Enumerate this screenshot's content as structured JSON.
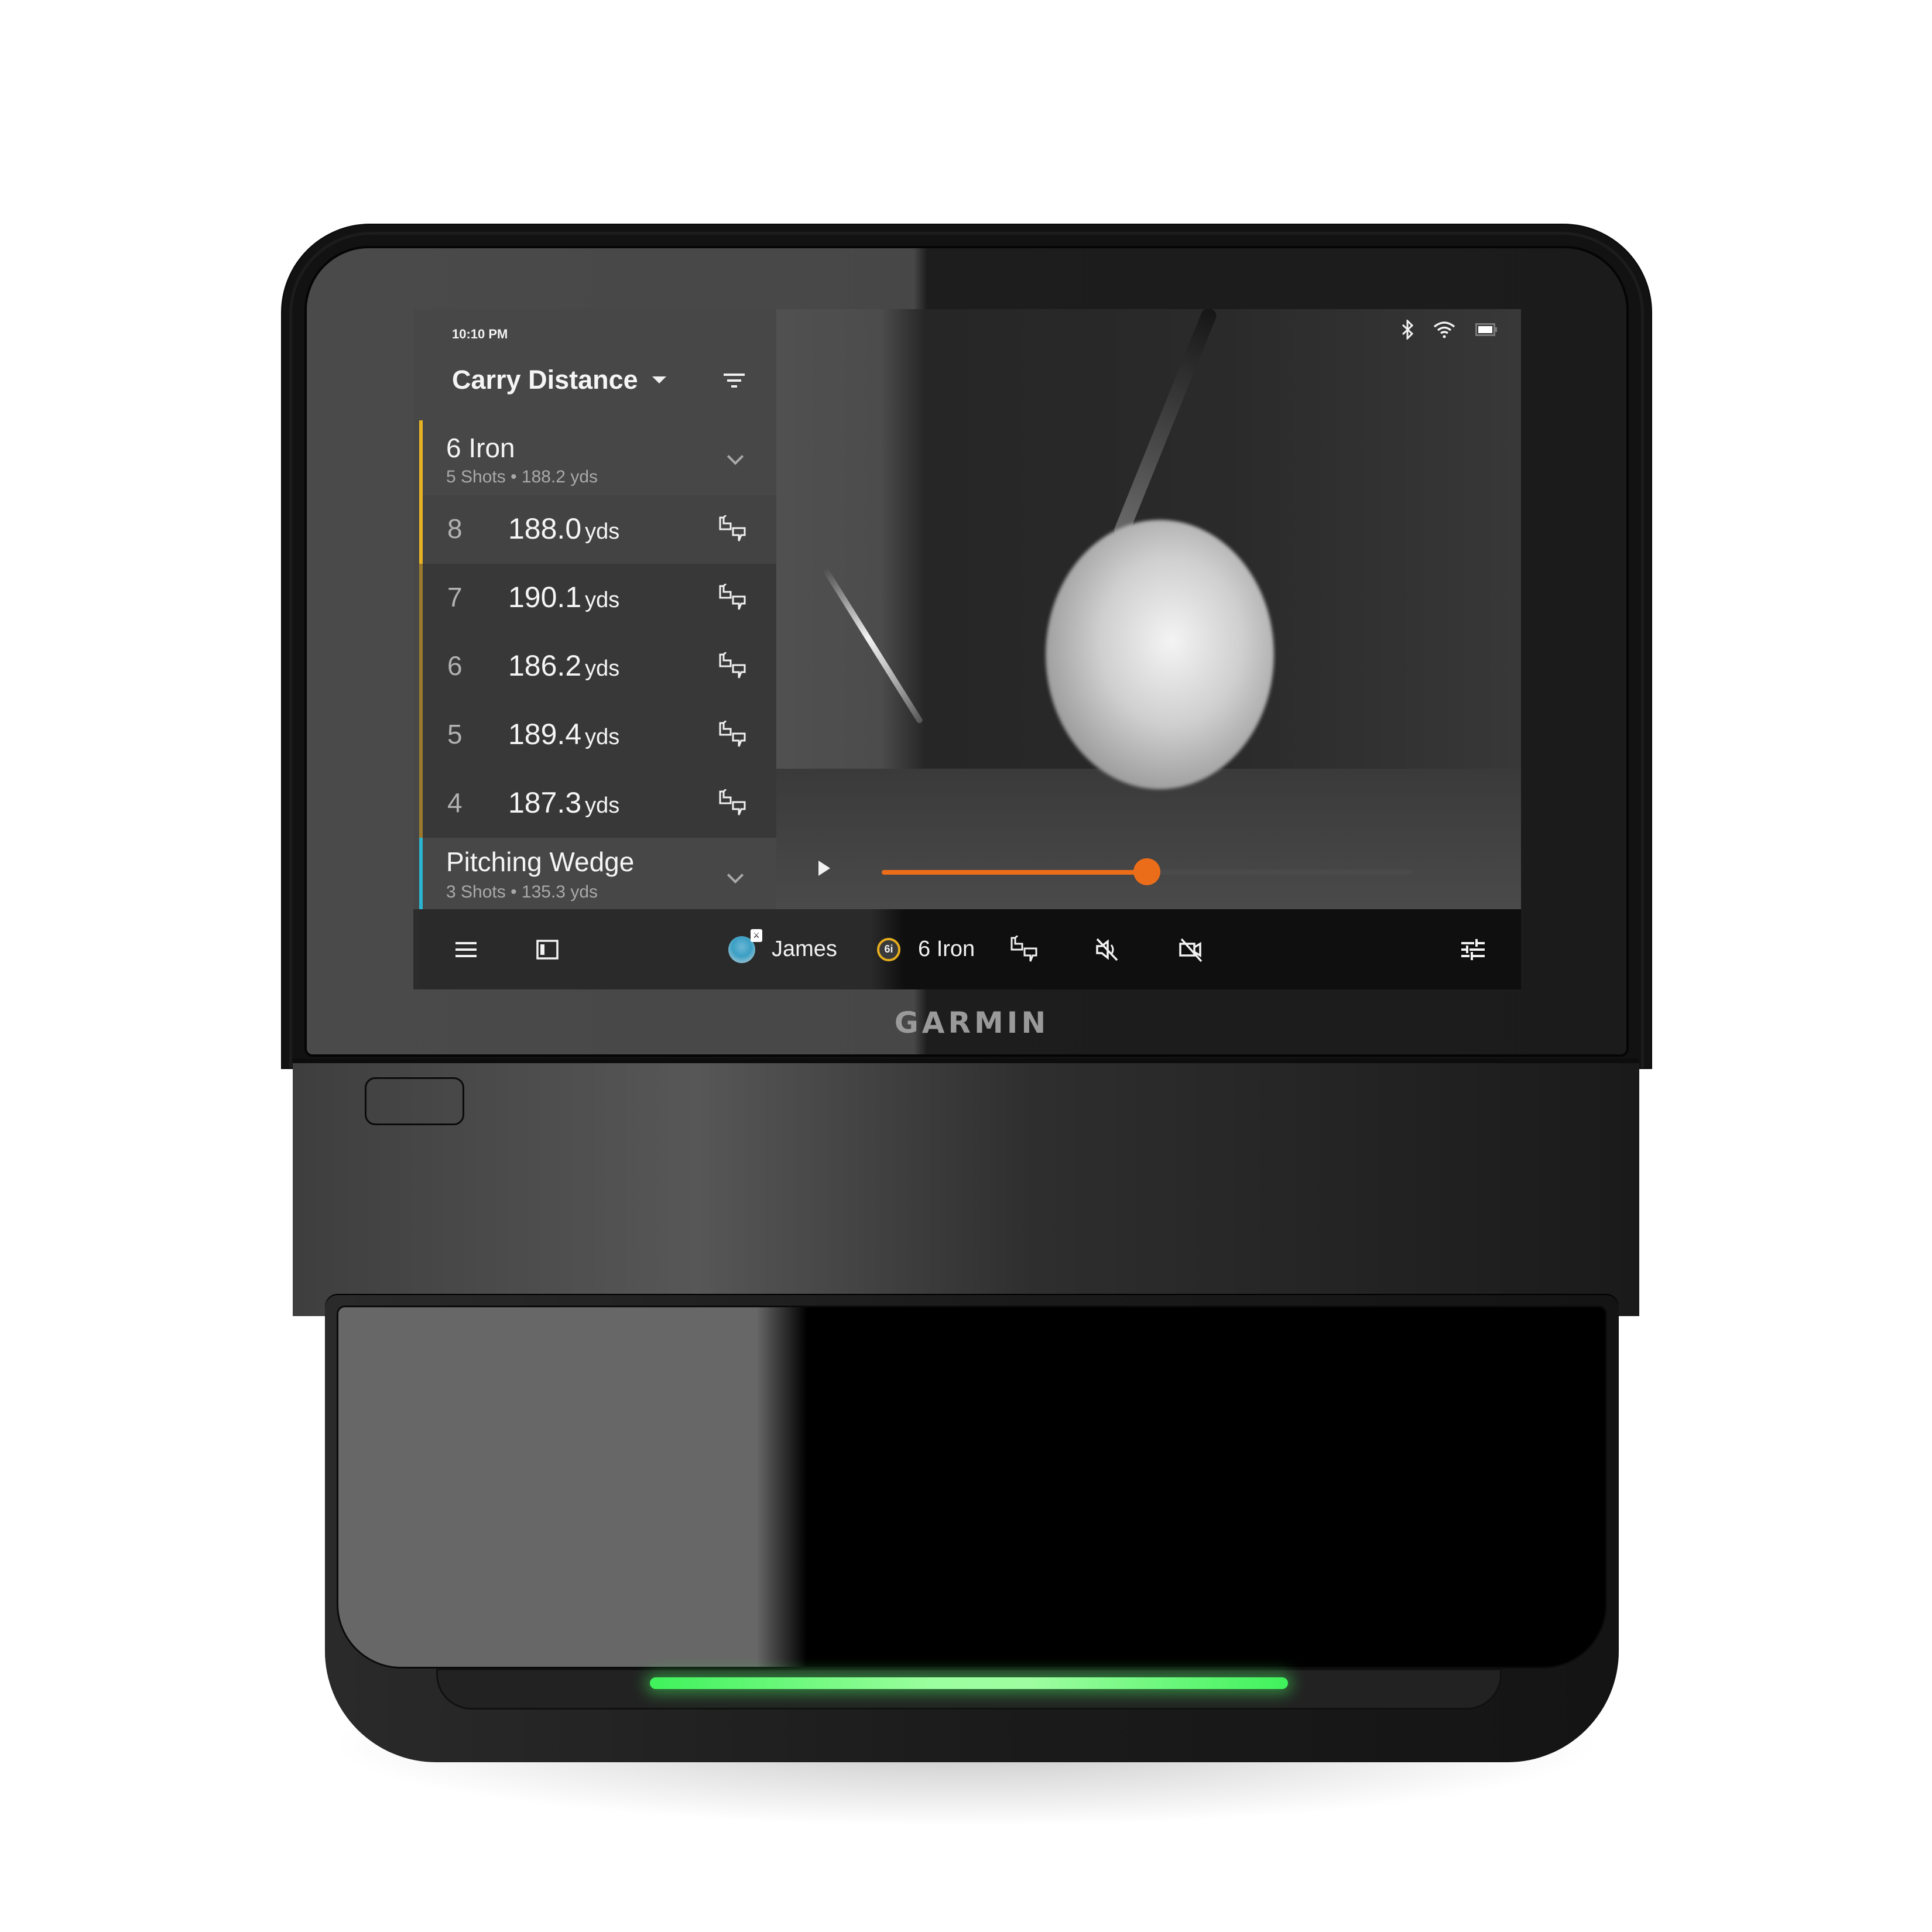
{
  "device": {
    "brand_logo": "GARMIN",
    "led_status_color": "#3ff25b"
  },
  "status_bar": {
    "time": "10:10 PM",
    "icons": [
      "bluetooth-icon",
      "wifi-icon",
      "battery-icon"
    ]
  },
  "side_panel": {
    "metric_selector": "Carry Distance",
    "filter_icon": "filter-icon",
    "groups": [
      {
        "club": "6 Iron",
        "summary": "5 Shots • 188.2 yds",
        "accent_color": "#e8b322",
        "expanded": true,
        "shots": [
          {
            "number": "8",
            "distance": "188.0",
            "unit": "yds",
            "selected": true
          },
          {
            "number": "7",
            "distance": "190.1",
            "unit": "yds",
            "selected": false
          },
          {
            "number": "6",
            "distance": "186.2",
            "unit": "yds",
            "selected": false
          },
          {
            "number": "5",
            "distance": "189.4",
            "unit": "yds",
            "selected": false
          },
          {
            "number": "4",
            "distance": "187.3",
            "unit": "yds",
            "selected": false
          }
        ]
      },
      {
        "club": "Pitching Wedge",
        "summary": "3 Shots • 135.3 yds",
        "accent_color": "#2bb5d1",
        "expanded": false
      }
    ]
  },
  "video_player": {
    "playback_progress": 0.5,
    "accent_color": "#ec6d19",
    "state": "paused"
  },
  "bottom_bar": {
    "menu_icon": "menu-icon",
    "layout_icon": "panel-layout-icon",
    "player_name": "James",
    "club_badge": "6i",
    "club_name": "6 Iron",
    "feedback_icon": "shot-feedback-icon",
    "audio_icon": "audio-off-icon",
    "camera_icon": "camera-off-icon",
    "settings_icon": "tune-icon"
  }
}
